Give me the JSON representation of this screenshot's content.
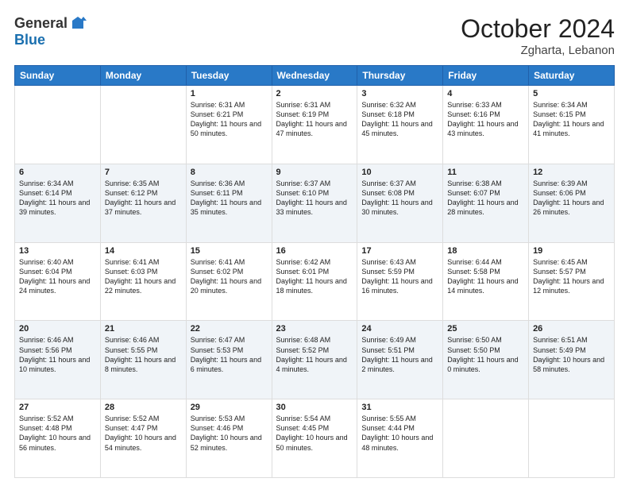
{
  "logo": {
    "general": "General",
    "blue": "Blue"
  },
  "header": {
    "month": "October 2024",
    "location": "Zgharta, Lebanon"
  },
  "weekdays": [
    "Sunday",
    "Monday",
    "Tuesday",
    "Wednesday",
    "Thursday",
    "Friday",
    "Saturday"
  ],
  "weeks": [
    [
      {
        "day": "",
        "info": ""
      },
      {
        "day": "",
        "info": ""
      },
      {
        "day": "1",
        "info": "Sunrise: 6:31 AM\nSunset: 6:21 PM\nDaylight: 11 hours and 50 minutes."
      },
      {
        "day": "2",
        "info": "Sunrise: 6:31 AM\nSunset: 6:19 PM\nDaylight: 11 hours and 47 minutes."
      },
      {
        "day": "3",
        "info": "Sunrise: 6:32 AM\nSunset: 6:18 PM\nDaylight: 11 hours and 45 minutes."
      },
      {
        "day": "4",
        "info": "Sunrise: 6:33 AM\nSunset: 6:16 PM\nDaylight: 11 hours and 43 minutes."
      },
      {
        "day": "5",
        "info": "Sunrise: 6:34 AM\nSunset: 6:15 PM\nDaylight: 11 hours and 41 minutes."
      }
    ],
    [
      {
        "day": "6",
        "info": "Sunrise: 6:34 AM\nSunset: 6:14 PM\nDaylight: 11 hours and 39 minutes."
      },
      {
        "day": "7",
        "info": "Sunrise: 6:35 AM\nSunset: 6:12 PM\nDaylight: 11 hours and 37 minutes."
      },
      {
        "day": "8",
        "info": "Sunrise: 6:36 AM\nSunset: 6:11 PM\nDaylight: 11 hours and 35 minutes."
      },
      {
        "day": "9",
        "info": "Sunrise: 6:37 AM\nSunset: 6:10 PM\nDaylight: 11 hours and 33 minutes."
      },
      {
        "day": "10",
        "info": "Sunrise: 6:37 AM\nSunset: 6:08 PM\nDaylight: 11 hours and 30 minutes."
      },
      {
        "day": "11",
        "info": "Sunrise: 6:38 AM\nSunset: 6:07 PM\nDaylight: 11 hours and 28 minutes."
      },
      {
        "day": "12",
        "info": "Sunrise: 6:39 AM\nSunset: 6:06 PM\nDaylight: 11 hours and 26 minutes."
      }
    ],
    [
      {
        "day": "13",
        "info": "Sunrise: 6:40 AM\nSunset: 6:04 PM\nDaylight: 11 hours and 24 minutes."
      },
      {
        "day": "14",
        "info": "Sunrise: 6:41 AM\nSunset: 6:03 PM\nDaylight: 11 hours and 22 minutes."
      },
      {
        "day": "15",
        "info": "Sunrise: 6:41 AM\nSunset: 6:02 PM\nDaylight: 11 hours and 20 minutes."
      },
      {
        "day": "16",
        "info": "Sunrise: 6:42 AM\nSunset: 6:01 PM\nDaylight: 11 hours and 18 minutes."
      },
      {
        "day": "17",
        "info": "Sunrise: 6:43 AM\nSunset: 5:59 PM\nDaylight: 11 hours and 16 minutes."
      },
      {
        "day": "18",
        "info": "Sunrise: 6:44 AM\nSunset: 5:58 PM\nDaylight: 11 hours and 14 minutes."
      },
      {
        "day": "19",
        "info": "Sunrise: 6:45 AM\nSunset: 5:57 PM\nDaylight: 11 hours and 12 minutes."
      }
    ],
    [
      {
        "day": "20",
        "info": "Sunrise: 6:46 AM\nSunset: 5:56 PM\nDaylight: 11 hours and 10 minutes."
      },
      {
        "day": "21",
        "info": "Sunrise: 6:46 AM\nSunset: 5:55 PM\nDaylight: 11 hours and 8 minutes."
      },
      {
        "day": "22",
        "info": "Sunrise: 6:47 AM\nSunset: 5:53 PM\nDaylight: 11 hours and 6 minutes."
      },
      {
        "day": "23",
        "info": "Sunrise: 6:48 AM\nSunset: 5:52 PM\nDaylight: 11 hours and 4 minutes."
      },
      {
        "day": "24",
        "info": "Sunrise: 6:49 AM\nSunset: 5:51 PM\nDaylight: 11 hours and 2 minutes."
      },
      {
        "day": "25",
        "info": "Sunrise: 6:50 AM\nSunset: 5:50 PM\nDaylight: 11 hours and 0 minutes."
      },
      {
        "day": "26",
        "info": "Sunrise: 6:51 AM\nSunset: 5:49 PM\nDaylight: 10 hours and 58 minutes."
      }
    ],
    [
      {
        "day": "27",
        "info": "Sunrise: 5:52 AM\nSunset: 4:48 PM\nDaylight: 10 hours and 56 minutes."
      },
      {
        "day": "28",
        "info": "Sunrise: 5:52 AM\nSunset: 4:47 PM\nDaylight: 10 hours and 54 minutes."
      },
      {
        "day": "29",
        "info": "Sunrise: 5:53 AM\nSunset: 4:46 PM\nDaylight: 10 hours and 52 minutes."
      },
      {
        "day": "30",
        "info": "Sunrise: 5:54 AM\nSunset: 4:45 PM\nDaylight: 10 hours and 50 minutes."
      },
      {
        "day": "31",
        "info": "Sunrise: 5:55 AM\nSunset: 4:44 PM\nDaylight: 10 hours and 48 minutes."
      },
      {
        "day": "",
        "info": ""
      },
      {
        "day": "",
        "info": ""
      }
    ]
  ]
}
